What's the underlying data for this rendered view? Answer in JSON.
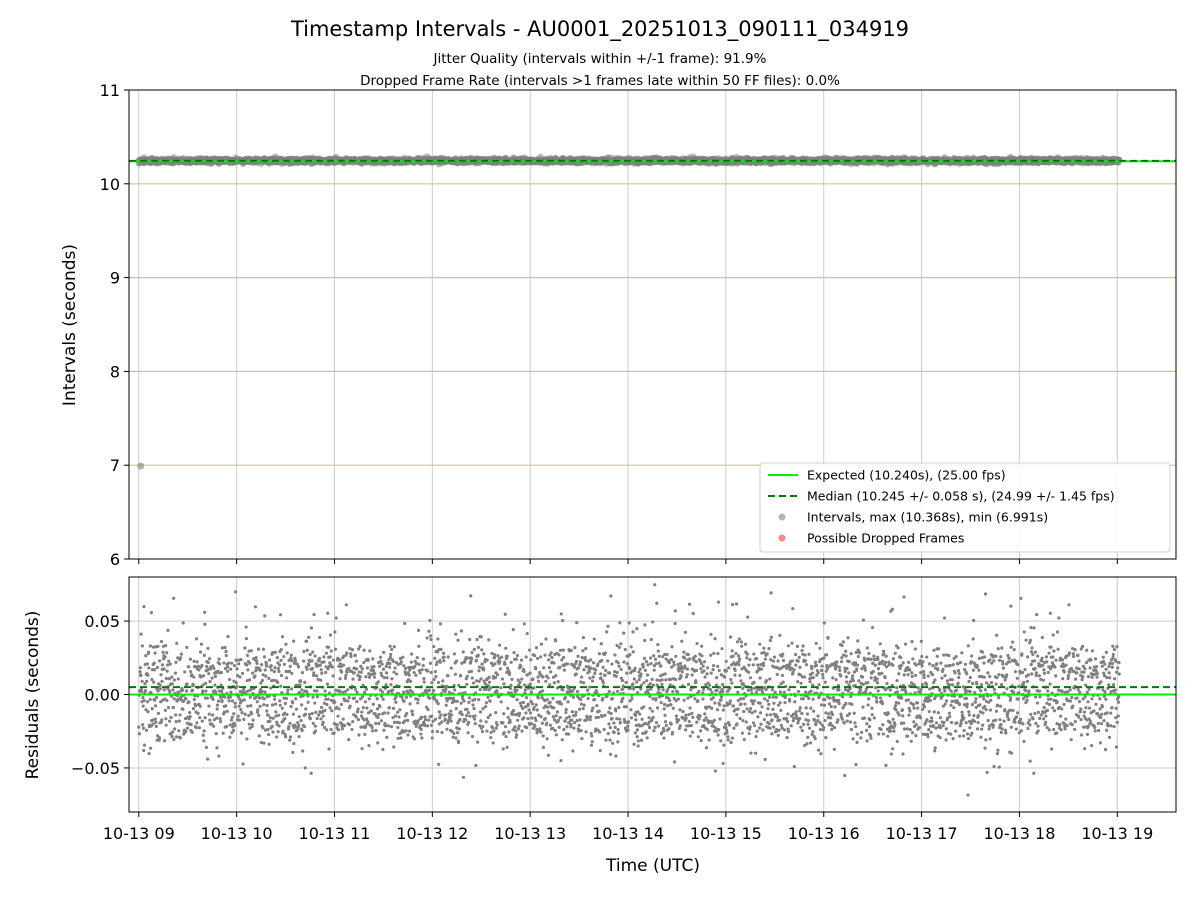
{
  "figure": {
    "title": "Timestamp Intervals - AU0001_20251013_090111_034919",
    "subtitle_1": "Jitter Quality (intervals within +/-1 frame): 91.9%",
    "subtitle_2": "Dropped Frame Rate (intervals >1 frames late within 50 FF files): 0.0%"
  },
  "colors": {
    "expected": "#00ee00",
    "median": "#007a00",
    "intervals": "#808080",
    "dropped": "#ff3030",
    "hline": "#d4c48a",
    "grid": "#cccccc"
  },
  "chart_data": [
    {
      "type": "scatter",
      "panel": "intervals",
      "ylabel": "Intervals (seconds)",
      "ylim": [
        6,
        11
      ],
      "yticks": [
        6,
        7,
        8,
        9,
        10,
        11
      ],
      "x_range_hours": [
        8.9,
        19.6
      ],
      "x_tick_hours": [
        9,
        10,
        11,
        12,
        13,
        14,
        15,
        16,
        17,
        18,
        19
      ],
      "reference_lines": [
        7,
        8,
        9,
        10
      ],
      "expected": 10.24,
      "median": 10.245,
      "median_std": 0.058,
      "interval_max": 10.368,
      "interval_min": 6.991,
      "outlier": {
        "x_hour": 9.02,
        "y": 6.991
      },
      "legend": {
        "position": "lower right",
        "entries": [
          {
            "label": "Expected (10.240s), (25.00 fps)",
            "kind": "solid-line",
            "color_key": "expected"
          },
          {
            "label": "Median (10.245 +/- 0.058 s), (24.99 +/- 1.45 fps)",
            "kind": "dashed-line",
            "color_key": "median"
          },
          {
            "label": "Intervals, max (10.368s), min (6.991s)",
            "kind": "dot",
            "color_key": "intervals"
          },
          {
            "label": "Possible Dropped Frames",
            "kind": "dot",
            "color_key": "dropped"
          }
        ]
      },
      "grid": true
    },
    {
      "type": "scatter",
      "panel": "residuals",
      "ylabel": "Residuals (seconds)",
      "xlabel": "Time (UTC)",
      "ylim": [
        -0.08,
        0.08
      ],
      "yticks": [
        -0.05,
        0.0,
        0.05
      ],
      "ytick_labels": [
        "−0.05",
        "0.00",
        "0.05"
      ],
      "x_range_hours": [
        8.9,
        19.6
      ],
      "x_tick_hours": [
        9,
        10,
        11,
        12,
        13,
        14,
        15,
        16,
        17,
        18,
        19
      ],
      "x_tick_labels": [
        "10-13 09",
        "10-13 10",
        "10-13 11",
        "10-13 12",
        "10-13 13",
        "10-13 14",
        "10-13 15",
        "10-13 16",
        "10-13 17",
        "10-13 18",
        "10-13 19"
      ],
      "zero_line": 0.0,
      "median_offset": 0.005,
      "point_count": 3800,
      "dominant_levels": [
        0.02,
        0.0,
        -0.02
      ],
      "spread": 0.08,
      "grid": true
    }
  ]
}
